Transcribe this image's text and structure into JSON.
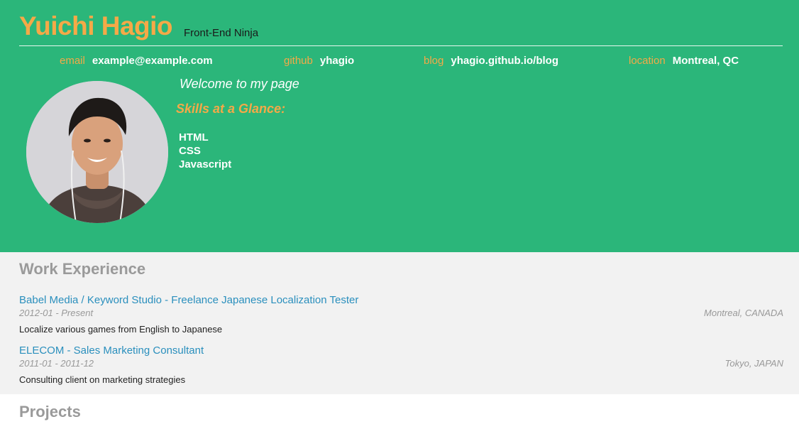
{
  "header": {
    "name": "Yuichi Hagio",
    "subtitle": "Front-End Ninja",
    "bg_color": "#2bb67a",
    "accent_color": "#f5a947"
  },
  "contact": [
    {
      "label": "email",
      "value": "example@example.com"
    },
    {
      "label": "github",
      "value": "yhagio"
    },
    {
      "label": "blog",
      "value": "yhagio.github.io/blog"
    },
    {
      "label": "location",
      "value": "Montreal, QC"
    }
  ],
  "intro": {
    "welcome": "Welcome to my page",
    "skills_title": "Skills at a Glance:",
    "skills": [
      "HTML",
      "CSS",
      "Javascript"
    ]
  },
  "work": {
    "title": "Work Experience",
    "jobs": [
      {
        "title": "Babel Media / Keyword Studio - Freelance Japanese Localization Tester",
        "dates": "2012-01 - Present",
        "location": "Montreal, CANADA",
        "description": "Localize various games from English to Japanese"
      },
      {
        "title": "ELECOM - Sales Marketing Consultant",
        "dates": "2011-01 - 2011-12",
        "location": "Tokyo, JAPAN",
        "description": "Consulting client on marketing strategies"
      }
    ]
  },
  "projects": {
    "title": "Projects"
  }
}
